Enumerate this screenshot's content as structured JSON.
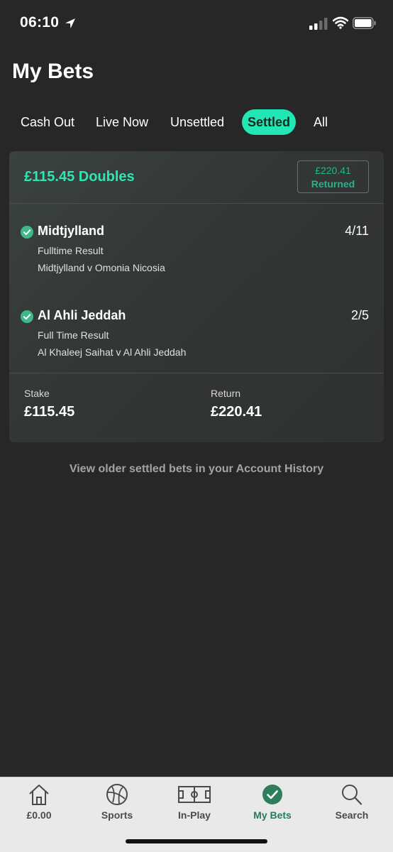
{
  "status_bar": {
    "time": "06:10",
    "icons": [
      "location-arrow-icon",
      "signal-icon",
      "wifi-icon",
      "battery-icon"
    ]
  },
  "page_title": "My Bets",
  "tabs": [
    {
      "label": "Cash Out",
      "active": false
    },
    {
      "label": "Live Now",
      "active": false
    },
    {
      "label": "Unsettled",
      "active": false
    },
    {
      "label": "Settled",
      "active": true
    },
    {
      "label": "All",
      "active": false
    }
  ],
  "bet": {
    "title": "£115.45 Doubles",
    "returned_amount": "£220.41",
    "returned_label": "Returned",
    "selections": [
      {
        "name": "Midtjylland",
        "odds": "4/11",
        "market": "Fulltime Result",
        "event": "Midtjylland v Omonia Nicosia",
        "status_icon": "check-circle-icon"
      },
      {
        "name": "Al Ahli Jeddah",
        "odds": "2/5",
        "market": "Full Time Result",
        "event": "Al Khaleej Saihat v Al Ahli Jeddah",
        "status_icon": "check-circle-icon"
      }
    ],
    "stake_label": "Stake",
    "stake_value": "£115.45",
    "return_label": "Return",
    "return_value": "£220.41"
  },
  "history_link": "View older settled bets in your Account History",
  "bottom_nav": [
    {
      "label": "£0.00",
      "icon": "home-icon",
      "active": false
    },
    {
      "label": "Sports",
      "icon": "football-icon",
      "active": false
    },
    {
      "label": "In-Play",
      "icon": "pitch-icon",
      "active": false
    },
    {
      "label": "My Bets",
      "icon": "check-circle-icon",
      "active": true
    },
    {
      "label": "Search",
      "icon": "search-icon",
      "active": false
    }
  ],
  "colors": {
    "background": "#272727",
    "accent": "#22e6b3",
    "returned": "#26b38d",
    "nav_active": "#2a7a5a",
    "nav_background": "#e9e9e9"
  }
}
